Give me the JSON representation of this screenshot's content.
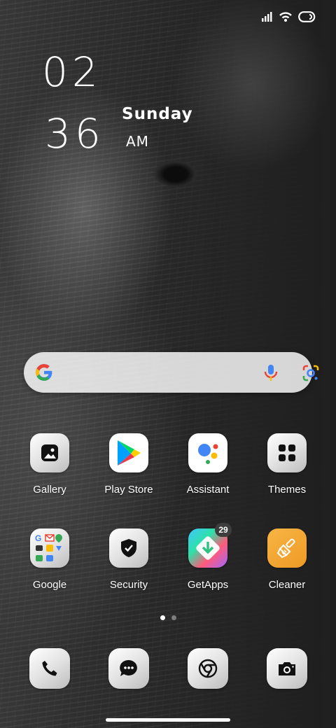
{
  "clock": {
    "hours": "02",
    "minutes": "36",
    "day": "Sunday",
    "ampm": "AM"
  },
  "status_bar": {
    "icons": [
      "signal-icon",
      "wifi-icon",
      "battery-icon"
    ]
  },
  "search_bar": {
    "icons": [
      "google-g-icon",
      "microphone-icon",
      "google-lens-icon"
    ]
  },
  "apps_row1": [
    {
      "label": "Gallery",
      "icon": "gallery-icon"
    },
    {
      "label": "Play Store",
      "icon": "play-store-icon"
    },
    {
      "label": "Assistant",
      "icon": "assistant-icon"
    },
    {
      "label": "Themes",
      "icon": "themes-icon"
    }
  ],
  "apps_row2": [
    {
      "label": "Google",
      "icon": "google-folder-icon"
    },
    {
      "label": "Security",
      "icon": "shield-icon"
    },
    {
      "label": "GetApps",
      "icon": "getapps-icon",
      "badge": "29"
    },
    {
      "label": "Cleaner",
      "icon": "broom-icon"
    }
  ],
  "page_indicator": {
    "count": 2,
    "active": 1
  },
  "dock": [
    "phone-icon",
    "messages-icon",
    "chrome-icon",
    "camera-icon"
  ],
  "colors": {
    "cleaner_orange": "#f0a030",
    "search_bg": "#f0f0f0"
  }
}
